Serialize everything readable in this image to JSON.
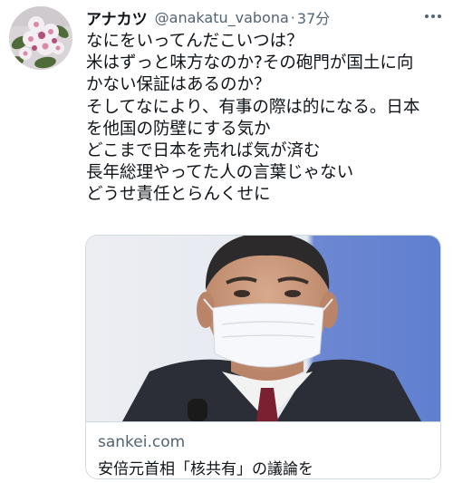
{
  "tweet": {
    "author": {
      "display_name": "アナカツ",
      "handle": "@anakatu_vabona",
      "separator": "·",
      "time": "37分"
    },
    "text_lines": [
      "なにをいってんだこいつは？",
      "米はずっと味方なのか?その砲門が国土に向",
      "かない保証はあるのか？",
      "そしてなにより、有事の際は的になる。日本",
      "を他国の防壁にする気か",
      "どこまで日本を売れば気が済む",
      "長年総理やってた人の言葉じゃない",
      "どうせ責任とらんくせに"
    ],
    "icons": {
      "more": "more-dots-icon"
    },
    "card": {
      "domain": "sankei.com",
      "title": "安倍元首相「核共有」の議論を"
    }
  },
  "colors": {
    "text_primary": "#0f1419",
    "text_secondary": "#536471",
    "border": "#cfd9de"
  }
}
